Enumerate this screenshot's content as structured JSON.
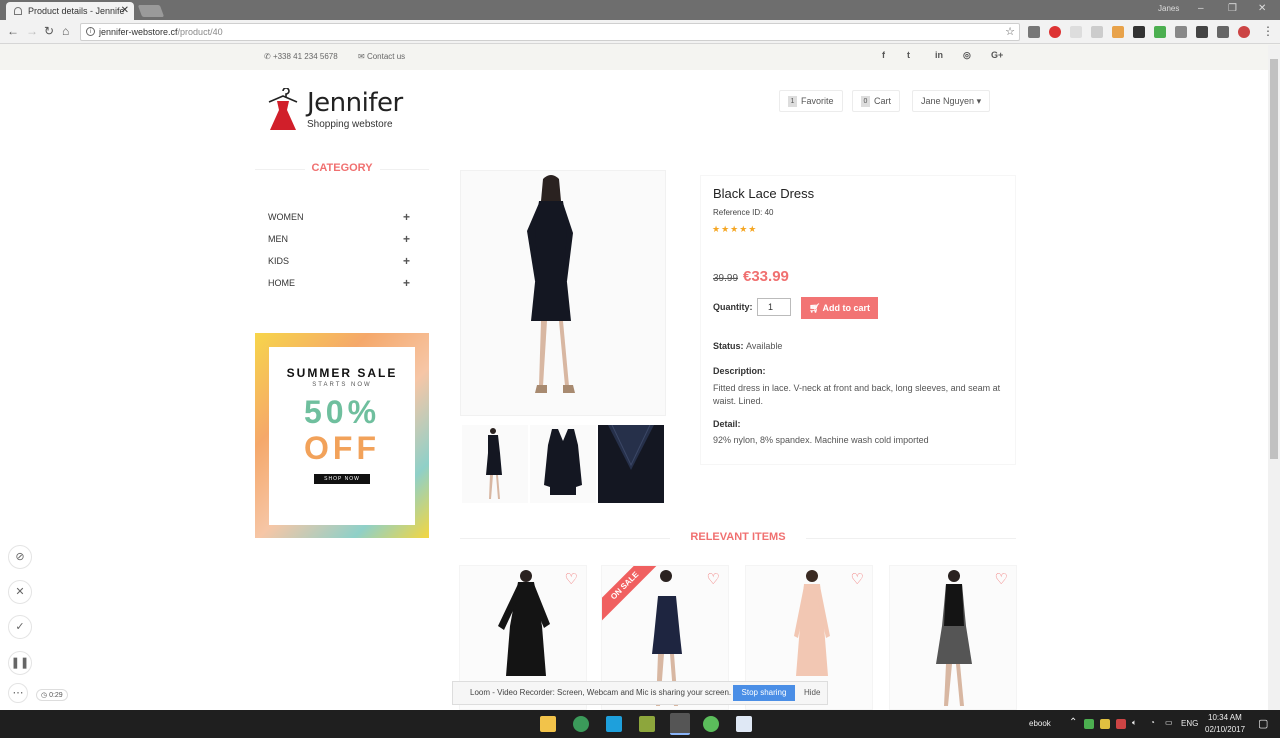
{
  "browser": {
    "tab_title": "Product details - Jennife",
    "url_host": "jennifer-webstore.cf",
    "url_path": "/product/40",
    "user": "Janes"
  },
  "topbar": {
    "phone": "+338 41 234 5678",
    "contact": "Contact us",
    "social": [
      "f",
      "t",
      "in",
      "◎",
      "G+"
    ]
  },
  "header": {
    "logo_name": "Jennifer",
    "logo_sub": "Shopping webstore",
    "favorite_label": "Favorite",
    "favorite_count": "1",
    "cart_label": "Cart",
    "cart_count": "0",
    "user_name": "Jane Nguyen"
  },
  "sidebar": {
    "title": "CATEGORY",
    "items": [
      {
        "label": "WOMEN"
      },
      {
        "label": "MEN"
      },
      {
        "label": "KIDS"
      },
      {
        "label": "HOME"
      }
    ],
    "promo": {
      "line1": "SUMMER SALE",
      "line2": "STARTS NOW",
      "line3": "50%",
      "line4": "OFF",
      "cta": "SHOP NOW"
    }
  },
  "product": {
    "name": "Black Lace Dress",
    "reference": "Reference ID: 40",
    "rating": 4.5,
    "stars": "★★★★★",
    "old_price": "39.99",
    "new_price": "€33.99",
    "quantity_label": "Quantity:",
    "quantity_value": "1",
    "add_to_cart": "Add to cart",
    "status_label": "Status:",
    "status_value": "Available",
    "description_label": "Description:",
    "description": "Fitted dress in lace. V-neck at front and back, long sleeves, and seam at waist. Lined.",
    "detail_label": "Detail:",
    "detail": "92% nylon, 8% spandex. Machine wash cold imported"
  },
  "relevant": {
    "title": "RELEVANT ITEMS",
    "sale_badge": "ON SALE"
  },
  "loom": {
    "time": "0:29",
    "message": "Loom - Video Recorder: Screen, Webcam and Mic is sharing your screen.",
    "stop": "Stop sharing",
    "hide": "Hide"
  },
  "taskbar": {
    "ebook": "ebook",
    "lang": "ENG",
    "time": "10:34 AM",
    "date": "02/10/2017"
  }
}
